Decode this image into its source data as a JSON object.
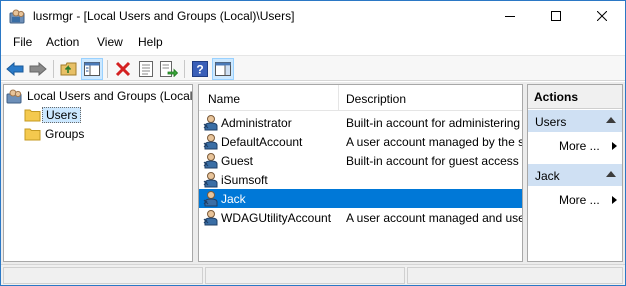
{
  "window": {
    "title": "lusrmgr - [Local Users and Groups (Local)\\Users]"
  },
  "menu": [
    {
      "label": "File"
    },
    {
      "label": "Action"
    },
    {
      "label": "View"
    },
    {
      "label": "Help"
    }
  ],
  "toolbar": {
    "buttons": [
      "back-arrow-icon",
      "forward-arrow-icon",
      "up-folder-icon",
      "show-hide-tree-icon",
      "delete-icon",
      "properties-icon",
      "export-list-icon",
      "help-icon",
      "show-hide-action-pane-icon"
    ]
  },
  "tree": {
    "root": "Local Users and Groups (Local)",
    "items": [
      {
        "label": "Users",
        "selected": true
      },
      {
        "label": "Groups",
        "selected": false
      }
    ]
  },
  "list": {
    "columns": [
      "Name",
      "Description"
    ],
    "rows": [
      {
        "name": "Administrator",
        "description": "Built-in account for administering"
      },
      {
        "name": "DefaultAccount",
        "description": "A user account managed by the s"
      },
      {
        "name": "Guest",
        "description": "Built-in account for guest access"
      },
      {
        "name": "iSumsoft",
        "description": ""
      },
      {
        "name": "Jack",
        "description": "",
        "selected": true
      },
      {
        "name": "WDAGUtilityAccount",
        "description": "A user account managed and use"
      }
    ]
  },
  "actions": {
    "title": "Actions",
    "groups": [
      {
        "label": "Users",
        "more": "More ..."
      },
      {
        "label": "Jack",
        "more": "More ..."
      }
    ]
  },
  "colors": {
    "selection": "#0078d7",
    "action_group": "#cfe0f3",
    "tree_selection": "#cce8ff"
  }
}
